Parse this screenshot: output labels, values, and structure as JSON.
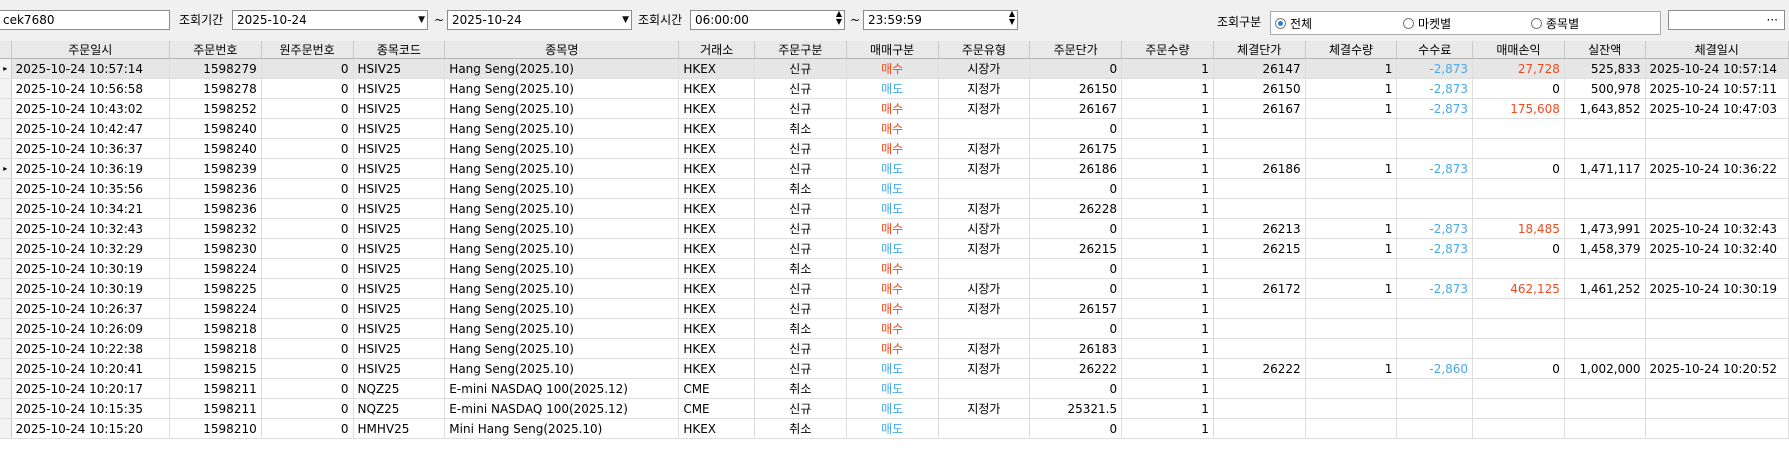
{
  "toolbar": {
    "account_value": "cek7680",
    "period_label": "조회기간",
    "date_from": "2025-10-24",
    "tilde": "~",
    "date_to": "2025-10-24",
    "time_label": "조회시간",
    "time_from": "06:00:00",
    "time_to": "23:59:59",
    "query_type_label": "조회구분",
    "radio_options": [
      {
        "label": "전체",
        "selected": true
      },
      {
        "label": "마켓별",
        "selected": false
      },
      {
        "label": "종목별",
        "selected": false
      }
    ],
    "lookup_button": "···",
    "dropdown_icon": "dropdown-arrow-icon",
    "spin_icon": "spinner-icon"
  },
  "colors": {
    "buy": "#f04a1a",
    "sell": "#4aa8e8",
    "negative_fee": "#4aa8e8",
    "positive_pnl": "#f04a1a"
  },
  "grid": {
    "columns": [
      "주문일시",
      "주문번호",
      "원주문번호",
      "종목코드",
      "종목명",
      "거래소",
      "주문구분",
      "매매구분",
      "주문유형",
      "주문단가",
      "주문수량",
      "체결단가",
      "체결수량",
      "수수료",
      "매매손익",
      "실잔액",
      "체결일시"
    ],
    "rows": [
      {
        "marker": "▸",
        "order_time": "2025-10-24 10:57:14",
        "order_no": "1598279",
        "orig_no": "0",
        "code": "HSIV25",
        "name": "Hang Seng(2025.10)",
        "exchange": "HKEX",
        "order_kind": "신규",
        "side": "매수",
        "side_type": "buy",
        "order_type": "시장가",
        "price": "0",
        "qty": "1",
        "fill_price": "26147",
        "fill_qty": "1",
        "fee": "-2,873",
        "pnl": "27,728",
        "pnl_color": "pos",
        "balance": "525,833",
        "fill_time": "2025-10-24 10:57:14"
      },
      {
        "marker": "",
        "order_time": "2025-10-24 10:56:58",
        "order_no": "1598278",
        "orig_no": "0",
        "code": "HSIV25",
        "name": "Hang Seng(2025.10)",
        "exchange": "HKEX",
        "order_kind": "신규",
        "side": "매도",
        "side_type": "sell",
        "order_type": "지정가",
        "price": "26150",
        "qty": "1",
        "fill_price": "26150",
        "fill_qty": "1",
        "fee": "-2,873",
        "pnl": "0",
        "pnl_color": "",
        "balance": "500,978",
        "fill_time": "2025-10-24 10:57:11"
      },
      {
        "marker": "",
        "order_time": "2025-10-24 10:43:02",
        "order_no": "1598252",
        "orig_no": "0",
        "code": "HSIV25",
        "name": "Hang Seng(2025.10)",
        "exchange": "HKEX",
        "order_kind": "신규",
        "side": "매수",
        "side_type": "buy",
        "order_type": "지정가",
        "price": "26167",
        "qty": "1",
        "fill_price": "26167",
        "fill_qty": "1",
        "fee": "-2,873",
        "pnl": "175,608",
        "pnl_color": "pos",
        "balance": "1,643,852",
        "fill_time": "2025-10-24 10:47:03"
      },
      {
        "marker": "",
        "order_time": "2025-10-24 10:42:47",
        "order_no": "1598240",
        "orig_no": "0",
        "code": "HSIV25",
        "name": "Hang Seng(2025.10)",
        "exchange": "HKEX",
        "order_kind": "취소",
        "side": "매수",
        "side_type": "buy",
        "order_type": "",
        "price": "0",
        "qty": "1",
        "fill_price": "",
        "fill_qty": "",
        "fee": "",
        "pnl": "",
        "pnl_color": "",
        "balance": "",
        "fill_time": ""
      },
      {
        "marker": "",
        "order_time": "2025-10-24 10:36:37",
        "order_no": "1598240",
        "orig_no": "0",
        "code": "HSIV25",
        "name": "Hang Seng(2025.10)",
        "exchange": "HKEX",
        "order_kind": "신규",
        "side": "매수",
        "side_type": "buy",
        "order_type": "지정가",
        "price": "26175",
        "qty": "1",
        "fill_price": "",
        "fill_qty": "",
        "fee": "",
        "pnl": "",
        "pnl_color": "",
        "balance": "",
        "fill_time": ""
      },
      {
        "marker": "▸",
        "order_time": "2025-10-24 10:36:19",
        "order_no": "1598239",
        "orig_no": "0",
        "code": "HSIV25",
        "name": "Hang Seng(2025.10)",
        "exchange": "HKEX",
        "order_kind": "신규",
        "side": "매도",
        "side_type": "sell",
        "order_type": "지정가",
        "price": "26186",
        "qty": "1",
        "fill_price": "26186",
        "fill_qty": "1",
        "fee": "-2,873",
        "pnl": "0",
        "pnl_color": "",
        "balance": "1,471,117",
        "fill_time": "2025-10-24 10:36:22"
      },
      {
        "marker": "",
        "order_time": "2025-10-24 10:35:56",
        "order_no": "1598236",
        "orig_no": "0",
        "code": "HSIV25",
        "name": "Hang Seng(2025.10)",
        "exchange": "HKEX",
        "order_kind": "취소",
        "side": "매도",
        "side_type": "sell",
        "order_type": "",
        "price": "0",
        "qty": "1",
        "fill_price": "",
        "fill_qty": "",
        "fee": "",
        "pnl": "",
        "pnl_color": "",
        "balance": "",
        "fill_time": ""
      },
      {
        "marker": "",
        "order_time": "2025-10-24 10:34:21",
        "order_no": "1598236",
        "orig_no": "0",
        "code": "HSIV25",
        "name": "Hang Seng(2025.10)",
        "exchange": "HKEX",
        "order_kind": "신규",
        "side": "매도",
        "side_type": "sell",
        "order_type": "지정가",
        "price": "26228",
        "qty": "1",
        "fill_price": "",
        "fill_qty": "",
        "fee": "",
        "pnl": "",
        "pnl_color": "",
        "balance": "",
        "fill_time": ""
      },
      {
        "marker": "",
        "order_time": "2025-10-24 10:32:43",
        "order_no": "1598232",
        "orig_no": "0",
        "code": "HSIV25",
        "name": "Hang Seng(2025.10)",
        "exchange": "HKEX",
        "order_kind": "신규",
        "side": "매수",
        "side_type": "buy",
        "order_type": "시장가",
        "price": "0",
        "qty": "1",
        "fill_price": "26213",
        "fill_qty": "1",
        "fee": "-2,873",
        "pnl": "18,485",
        "pnl_color": "pos",
        "balance": "1,473,991",
        "fill_time": "2025-10-24 10:32:43"
      },
      {
        "marker": "",
        "order_time": "2025-10-24 10:32:29",
        "order_no": "1598230",
        "orig_no": "0",
        "code": "HSIV25",
        "name": "Hang Seng(2025.10)",
        "exchange": "HKEX",
        "order_kind": "신규",
        "side": "매도",
        "side_type": "sell",
        "order_type": "지정가",
        "price": "26215",
        "qty": "1",
        "fill_price": "26215",
        "fill_qty": "1",
        "fee": "-2,873",
        "pnl": "0",
        "pnl_color": "",
        "balance": "1,458,379",
        "fill_time": "2025-10-24 10:32:40"
      },
      {
        "marker": "",
        "order_time": "2025-10-24 10:30:19",
        "order_no": "1598224",
        "orig_no": "0",
        "code": "HSIV25",
        "name": "Hang Seng(2025.10)",
        "exchange": "HKEX",
        "order_kind": "취소",
        "side": "매수",
        "side_type": "buy",
        "order_type": "",
        "price": "0",
        "qty": "1",
        "fill_price": "",
        "fill_qty": "",
        "fee": "",
        "pnl": "",
        "pnl_color": "",
        "balance": "",
        "fill_time": ""
      },
      {
        "marker": "",
        "order_time": "2025-10-24 10:30:19",
        "order_no": "1598225",
        "orig_no": "0",
        "code": "HSIV25",
        "name": "Hang Seng(2025.10)",
        "exchange": "HKEX",
        "order_kind": "신규",
        "side": "매수",
        "side_type": "buy",
        "order_type": "시장가",
        "price": "0",
        "qty": "1",
        "fill_price": "26172",
        "fill_qty": "1",
        "fee": "-2,873",
        "pnl": "462,125",
        "pnl_color": "pos",
        "balance": "1,461,252",
        "fill_time": "2025-10-24 10:30:19"
      },
      {
        "marker": "",
        "order_time": "2025-10-24 10:26:37",
        "order_no": "1598224",
        "orig_no": "0",
        "code": "HSIV25",
        "name": "Hang Seng(2025.10)",
        "exchange": "HKEX",
        "order_kind": "신규",
        "side": "매수",
        "side_type": "buy",
        "order_type": "지정가",
        "price": "26157",
        "qty": "1",
        "fill_price": "",
        "fill_qty": "",
        "fee": "",
        "pnl": "",
        "pnl_color": "",
        "balance": "",
        "fill_time": ""
      },
      {
        "marker": "",
        "order_time": "2025-10-24 10:26:09",
        "order_no": "1598218",
        "orig_no": "0",
        "code": "HSIV25",
        "name": "Hang Seng(2025.10)",
        "exchange": "HKEX",
        "order_kind": "취소",
        "side": "매수",
        "side_type": "buy",
        "order_type": "",
        "price": "0",
        "qty": "1",
        "fill_price": "",
        "fill_qty": "",
        "fee": "",
        "pnl": "",
        "pnl_color": "",
        "balance": "",
        "fill_time": ""
      },
      {
        "marker": "",
        "order_time": "2025-10-24 10:22:38",
        "order_no": "1598218",
        "orig_no": "0",
        "code": "HSIV25",
        "name": "Hang Seng(2025.10)",
        "exchange": "HKEX",
        "order_kind": "신규",
        "side": "매수",
        "side_type": "buy",
        "order_type": "지정가",
        "price": "26183",
        "qty": "1",
        "fill_price": "",
        "fill_qty": "",
        "fee": "",
        "pnl": "",
        "pnl_color": "",
        "balance": "",
        "fill_time": ""
      },
      {
        "marker": "",
        "order_time": "2025-10-24 10:20:41",
        "order_no": "1598215",
        "orig_no": "0",
        "code": "HSIV25",
        "name": "Hang Seng(2025.10)",
        "exchange": "HKEX",
        "order_kind": "신규",
        "side": "매도",
        "side_type": "sell",
        "order_type": "지정가",
        "price": "26222",
        "qty": "1",
        "fill_price": "26222",
        "fill_qty": "1",
        "fee": "-2,860",
        "pnl": "0",
        "pnl_color": "",
        "balance": "1,002,000",
        "fill_time": "2025-10-24 10:20:52"
      },
      {
        "marker": "",
        "order_time": "2025-10-24 10:20:17",
        "order_no": "1598211",
        "orig_no": "0",
        "code": "NQZ25",
        "name": "E-mini NASDAQ 100(2025.12)",
        "exchange": "CME",
        "order_kind": "취소",
        "side": "매도",
        "side_type": "sell",
        "order_type": "",
        "price": "0",
        "qty": "1",
        "fill_price": "",
        "fill_qty": "",
        "fee": "",
        "pnl": "",
        "pnl_color": "",
        "balance": "",
        "fill_time": ""
      },
      {
        "marker": "",
        "order_time": "2025-10-24 10:15:35",
        "order_no": "1598211",
        "orig_no": "0",
        "code": "NQZ25",
        "name": "E-mini NASDAQ 100(2025.12)",
        "exchange": "CME",
        "order_kind": "신규",
        "side": "매도",
        "side_type": "sell",
        "order_type": "지정가",
        "price": "25321.5",
        "qty": "1",
        "fill_price": "",
        "fill_qty": "",
        "fee": "",
        "pnl": "",
        "pnl_color": "",
        "balance": "",
        "fill_time": ""
      },
      {
        "marker": "",
        "order_time": "2025-10-24 10:15:20",
        "order_no": "1598210",
        "orig_no": "0",
        "code": "HMHV25",
        "name": "Mini Hang Seng(2025.10)",
        "exchange": "HKEX",
        "order_kind": "취소",
        "side": "매도",
        "side_type": "sell",
        "order_type": "",
        "price": "0",
        "qty": "1",
        "fill_price": "",
        "fill_qty": "",
        "fee": "",
        "pnl": "",
        "pnl_color": "",
        "balance": "",
        "fill_time": ""
      }
    ]
  }
}
